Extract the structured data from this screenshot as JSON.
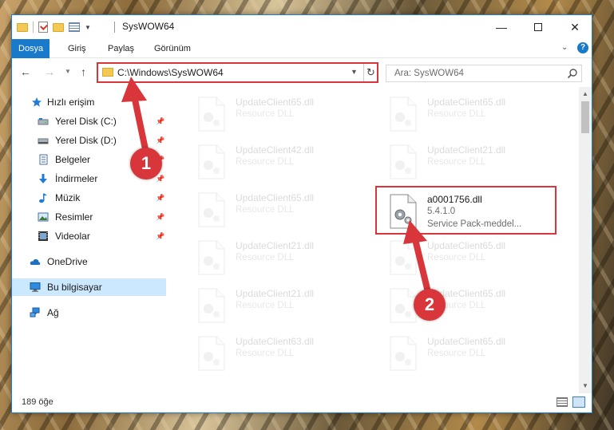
{
  "window": {
    "title": "SysWOW64",
    "min_glyph": "—",
    "close_glyph": "✕"
  },
  "ribbon": {
    "tabs": [
      {
        "label": "Dosya",
        "active": true
      },
      {
        "label": "Giriş",
        "active": false
      },
      {
        "label": "Paylaş",
        "active": false
      },
      {
        "label": "Görünüm",
        "active": false
      }
    ],
    "help_glyph": "?"
  },
  "navigation": {
    "address_path": "C:\\Windows\\SysWOW64",
    "search_placeholder": "Ara: SysWOW64"
  },
  "sidebar": {
    "items": [
      {
        "label": "Hızlı erişim",
        "icon": "star-icon",
        "pinned": false
      },
      {
        "label": "Yerel Disk (C:)",
        "icon": "drive-icon",
        "pinned": true
      },
      {
        "label": "Yerel Disk (D:)",
        "icon": "drive-icon",
        "pinned": true
      },
      {
        "label": "Belgeler",
        "icon": "documents-icon",
        "pinned": true
      },
      {
        "label": "İndirmeler",
        "icon": "downloads-icon",
        "pinned": true
      },
      {
        "label": "Müzik",
        "icon": "music-icon",
        "pinned": true
      },
      {
        "label": "Resimler",
        "icon": "pictures-icon",
        "pinned": true
      },
      {
        "label": "Videolar",
        "icon": "videos-icon",
        "pinned": true
      },
      {
        "label": "OneDrive",
        "icon": "cloud-icon",
        "pinned": false
      },
      {
        "label": "Bu bilgisayar",
        "icon": "computer-icon",
        "pinned": false,
        "selected": true
      },
      {
        "label": "Ağ",
        "icon": "network-icon",
        "pinned": false
      }
    ]
  },
  "files": {
    "left_column": [
      {
        "name": "UpdateClient65.dll",
        "type": "Resource DLL"
      },
      {
        "name": "UpdateClient42.dll",
        "type": "Resource DLL"
      },
      {
        "name": "UpdateClient65.dll",
        "type": "Resource DLL"
      },
      {
        "name": "UpdateClient21.dll",
        "type": "Resource DLL"
      },
      {
        "name": "UpdateClient21.dll",
        "type": "Resource DLL"
      },
      {
        "name": "UpdateClient63.dll",
        "type": "Resource DLL"
      }
    ],
    "right_column": [
      {
        "name": "UpdateClient65.dll",
        "type": "Resource DLL"
      },
      {
        "name": "UpdateClient21.dll",
        "type": "Resource DLL"
      },
      {
        "name": "UpdateClient65.dll",
        "type": "Resource DLL"
      },
      {
        "name": "UpdateClient65.dll",
        "type": "Resource DLL"
      },
      {
        "name": "UpdateClient65.dll",
        "type": "Resource DLL"
      }
    ],
    "highlighted": {
      "name": "a0001756.dll",
      "version": "5.4.1.0",
      "description": "Service Pack-meddel..."
    }
  },
  "status": {
    "item_count": "189 öğe"
  },
  "annotations": {
    "step1": "1",
    "step2": "2",
    "highlight_color": "#d8363a"
  }
}
